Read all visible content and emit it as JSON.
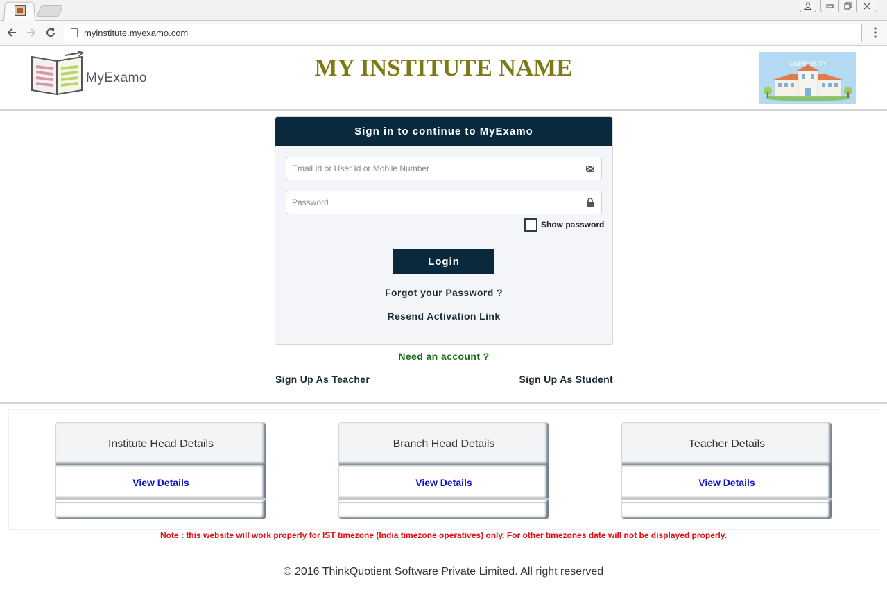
{
  "browser": {
    "url": "myinstitute.myexamo.com",
    "window_controls": {
      "minimize": "▭",
      "maximize": "⧉",
      "close": "✕"
    }
  },
  "header": {
    "logo_text": "MyExamo",
    "institute_title": "MY INSTITUTE NAME",
    "university_image_label": "UNIVERSITY"
  },
  "login": {
    "heading": "Sign in to continue to MyExamo",
    "email_placeholder": "Email Id or User Id or Mobile Number",
    "password_placeholder": "Password",
    "show_password_label": "Show password",
    "show_password_checked": false,
    "login_button": "Login",
    "forgot_password": "Forgot your Password ?",
    "resend_activation": "Resend Activation Link"
  },
  "signup": {
    "need_account": "Need an account ?",
    "teacher": "Sign Up As Teacher",
    "student": "Sign Up As Student"
  },
  "panels": [
    {
      "title": "Institute Head Details",
      "link": "View Details"
    },
    {
      "title": "Branch Head Details",
      "link": "View Details"
    },
    {
      "title": "Teacher Details",
      "link": "View Details"
    }
  ],
  "footer": {
    "note": "Note : this website will work properly for IST timezone (India timezone operatives) only. For other timezones date will not be displayed properly.",
    "copyright": "© 2016 ThinkQuotient Software Private Limited. All right reserved"
  },
  "colors": {
    "primary_dark": "#082a3c",
    "title_olive": "#7d7a13",
    "link_blue": "#0d10c9",
    "need_account_green": "#1a6b1a",
    "note_red": "#e01010"
  },
  "icons": {
    "email_field": "envelope-icon",
    "password_field": "lock-icon",
    "back": "arrow-left-icon",
    "forward": "arrow-right-icon",
    "reload": "reload-icon",
    "menu": "kebab-menu-icon",
    "profile": "user-icon"
  }
}
